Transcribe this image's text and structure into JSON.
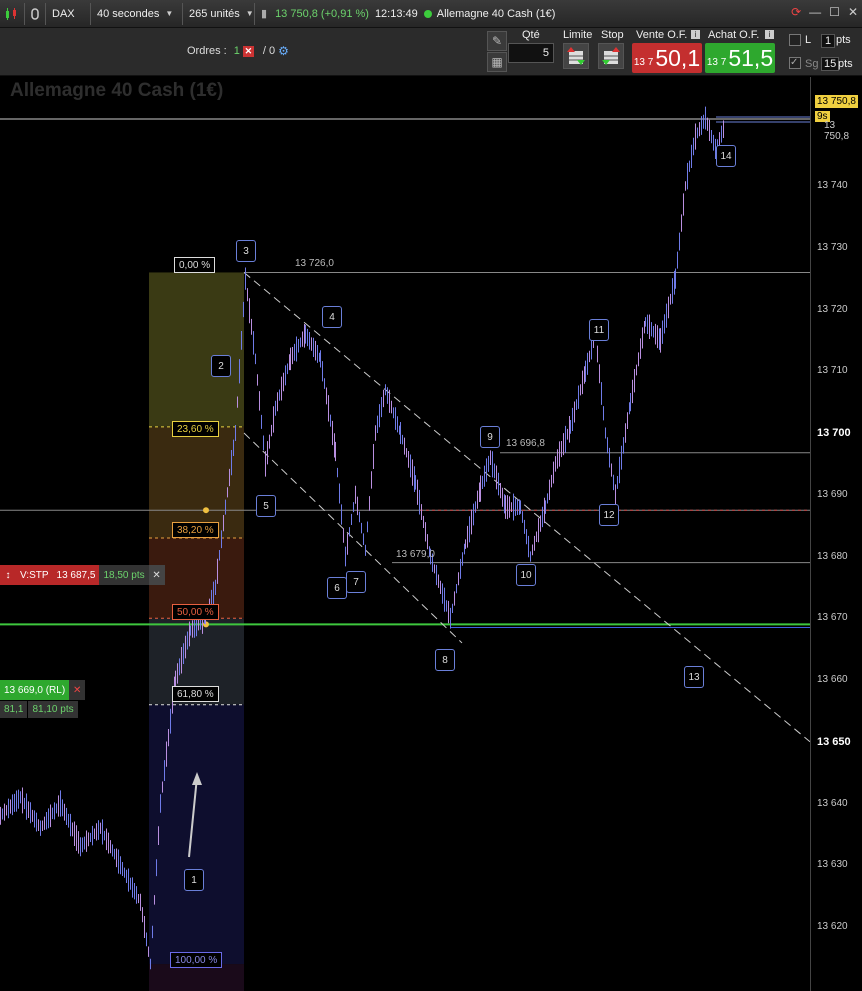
{
  "toolbar": {
    "instrument": "DAX",
    "interval": "40 secondes",
    "units": "265 unités",
    "price_change": "13 750,8 (+0,91 %)",
    "time": "12:13:49",
    "product": "Allemagne 40 Cash (1€)"
  },
  "orders": {
    "label": "Ordres :",
    "count_a": "1",
    "count_b": "/ 0"
  },
  "order_ticket": {
    "qty_label": "Qté",
    "qty_value": "5",
    "limite_label": "Limite",
    "stop_label": "Stop",
    "sell_label": "Vente O.F.",
    "sell_prefix": "13 7",
    "sell_big": "50,1",
    "buy_label": "Achat O.F.",
    "buy_prefix": "13 7",
    "buy_big": "51,5",
    "l_label": "L",
    "pts_label": "pts",
    "l_value": "1",
    "sg_label": "Sg",
    "sg_value": "15",
    "sg_pts": "pts"
  },
  "chart": {
    "title": "Allemagne 40 Cash (1€)",
    "current_price": "13 750,8",
    "countdown": "9s",
    "price_tag2": "13 750,8",
    "y_ticks": [
      "13 740",
      "13 730",
      "13 720",
      "13 710",
      "13 700",
      "13 690",
      "13 680",
      "13 670",
      "13 660",
      "13 650",
      "13 640",
      "13 630",
      "13 620"
    ],
    "fib_levels": [
      "0,00 %",
      "23,60 %",
      "38,20 %",
      "50,00 %",
      "61,80 %",
      "100,00 %"
    ],
    "level_labels": [
      "13 726,0",
      "13 696,8",
      "13 679,0"
    ],
    "wave_labels": [
      "1",
      "2",
      "3",
      "4",
      "5",
      "6",
      "7",
      "8",
      "9",
      "10",
      "11",
      "12",
      "13",
      "14"
    ],
    "stop_order": {
      "label": "V:STP",
      "price": "13 687,5",
      "pts": "18,50 pts"
    },
    "limit_order": {
      "price": "13 669,0 (RL)",
      "qty": "81,1",
      "pts": "81,10 pts"
    },
    "colors": {
      "green_line": "#3ec73e",
      "sell": "#c42f2f",
      "buy": "#2ea82e",
      "candle": "#b98fe0"
    }
  },
  "chart_data": {
    "type": "line",
    "title": "Allemagne 40 Cash (1€)",
    "ylim": [
      13610,
      13758
    ],
    "y_ticks": [
      13620,
      13630,
      13640,
      13650,
      13660,
      13670,
      13680,
      13690,
      13700,
      13710,
      13720,
      13730,
      13740
    ],
    "price_path": [
      [
        0,
        13638
      ],
      [
        20,
        13641
      ],
      [
        40,
        13636
      ],
      [
        60,
        13640
      ],
      [
        80,
        13633
      ],
      [
        100,
        13636
      ],
      [
        120,
        13630
      ],
      [
        140,
        13624
      ],
      [
        150,
        13614
      ],
      [
        160,
        13640
      ],
      [
        175,
        13660
      ],
      [
        190,
        13668
      ],
      [
        205,
        13670
      ],
      [
        215,
        13675
      ],
      [
        225,
        13688
      ],
      [
        235,
        13700
      ],
      [
        245,
        13725
      ],
      [
        255,
        13712
      ],
      [
        265,
        13695
      ],
      [
        275,
        13704
      ],
      [
        290,
        13712
      ],
      [
        305,
        13716
      ],
      [
        320,
        13712
      ],
      [
        335,
        13697
      ],
      [
        345,
        13680
      ],
      [
        355,
        13690
      ],
      [
        365,
        13681
      ],
      [
        375,
        13700
      ],
      [
        385,
        13707
      ],
      [
        400,
        13700
      ],
      [
        415,
        13692
      ],
      [
        430,
        13680
      ],
      [
        450,
        13670
      ],
      [
        465,
        13682
      ],
      [
        480,
        13691
      ],
      [
        490,
        13696
      ],
      [
        505,
        13688
      ],
      [
        520,
        13688
      ],
      [
        530,
        13680
      ],
      [
        545,
        13688
      ],
      [
        555,
        13695
      ],
      [
        570,
        13701
      ],
      [
        585,
        13710
      ],
      [
        595,
        13716
      ],
      [
        605,
        13700
      ],
      [
        615,
        13690
      ],
      [
        630,
        13705
      ],
      [
        645,
        13718
      ],
      [
        660,
        13715
      ],
      [
        675,
        13725
      ],
      [
        685,
        13740
      ],
      [
        695,
        13748
      ],
      [
        705,
        13751
      ],
      [
        715,
        13746
      ],
      [
        725,
        13750
      ]
    ]
  }
}
